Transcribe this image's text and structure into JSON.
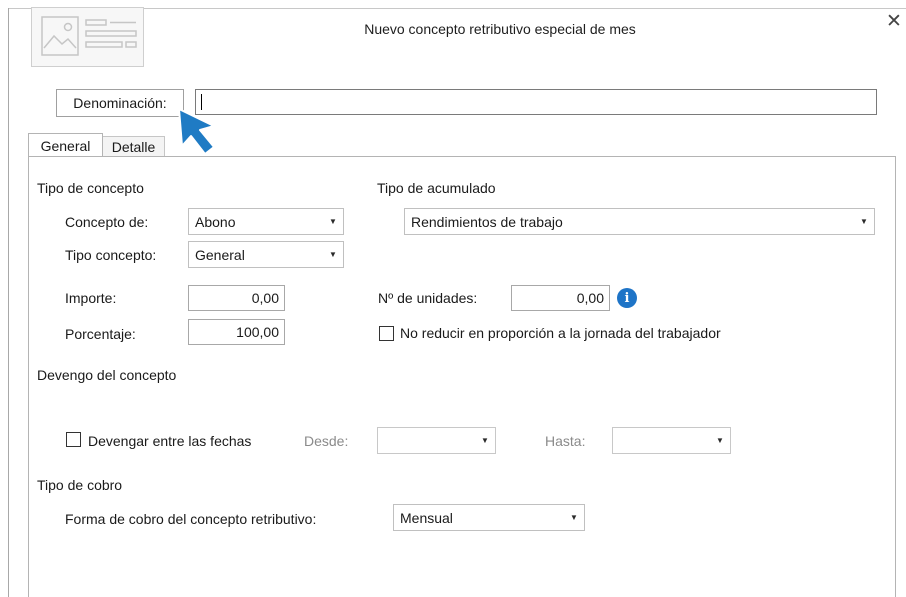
{
  "dialog": {
    "title": "Nuevo concepto retributivo especial de mes",
    "close_glyph": "✕",
    "thumbnail_icon": "image-form-icon"
  },
  "denominacion": {
    "label": "Denominación:",
    "value": ""
  },
  "tabs": [
    {
      "label": "General",
      "active": true
    },
    {
      "label": "Detalle",
      "active": false
    }
  ],
  "tipo_concepto_section": {
    "heading": "Tipo de concepto",
    "concepto_de_label": "Concepto de:",
    "concepto_de_value": "Abono",
    "tipo_concepto_label": "Tipo concepto:",
    "tipo_concepto_value": "General",
    "importe_label": "Importe:",
    "importe_value": "0,00",
    "porcentaje_label": "Porcentaje:",
    "porcentaje_value": "100,00"
  },
  "tipo_acumulado_section": {
    "heading": "Tipo de acumulado",
    "acumulado_value": "Rendimientos de trabajo",
    "unidades_label": "Nº de unidades:",
    "unidades_value": "0,00",
    "no_reducir_label": "No reducir en proporción a la jornada del trabajador",
    "no_reducir_checked": false
  },
  "devengo_section": {
    "heading": "Devengo del concepto",
    "devengar_label": "Devengar entre las fechas",
    "devengar_checked": false,
    "desde_label": "Desde:",
    "desde_value": "",
    "hasta_label": "Hasta:",
    "hasta_value": ""
  },
  "cobro_section": {
    "heading": "Tipo de cobro",
    "forma_label": "Forma de cobro del concepto retributivo:",
    "forma_value": "Mensual"
  },
  "colors": {
    "info_icon": "#1e74c7",
    "pointer": "#1f7bc4"
  }
}
